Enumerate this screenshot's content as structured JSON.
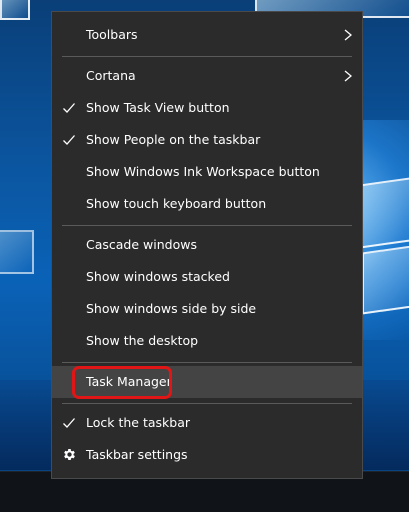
{
  "menu": {
    "items": [
      {
        "id": "toolbars",
        "label": "Toolbars",
        "checked": false,
        "submenu": true
      },
      {
        "id": "cortana",
        "label": "Cortana",
        "checked": false,
        "submenu": true
      },
      {
        "id": "show-task-view",
        "label": "Show Task View button",
        "checked": true
      },
      {
        "id": "show-people",
        "label": "Show People on the taskbar",
        "checked": true
      },
      {
        "id": "show-ink",
        "label": "Show Windows Ink Workspace button",
        "checked": false
      },
      {
        "id": "show-touch-keyboard",
        "label": "Show touch keyboard button",
        "checked": false
      },
      {
        "id": "cascade",
        "label": "Cascade windows",
        "checked": false
      },
      {
        "id": "stacked",
        "label": "Show windows stacked",
        "checked": false
      },
      {
        "id": "side-by-side",
        "label": "Show windows side by side",
        "checked": false
      },
      {
        "id": "show-desktop",
        "label": "Show the desktop",
        "checked": false
      },
      {
        "id": "task-manager",
        "label": "Task Manager",
        "checked": false,
        "highlighted": true
      },
      {
        "id": "lock-taskbar",
        "label": "Lock the taskbar",
        "checked": true
      },
      {
        "id": "taskbar-settings",
        "label": "Taskbar settings",
        "icon": "gear-icon"
      }
    ]
  },
  "colors": {
    "menu_background": "#2b2b2b",
    "hover_background": "#444444",
    "highlight_border": "#e01616",
    "text": "#ffffff",
    "separator": "#5a5a5a"
  }
}
